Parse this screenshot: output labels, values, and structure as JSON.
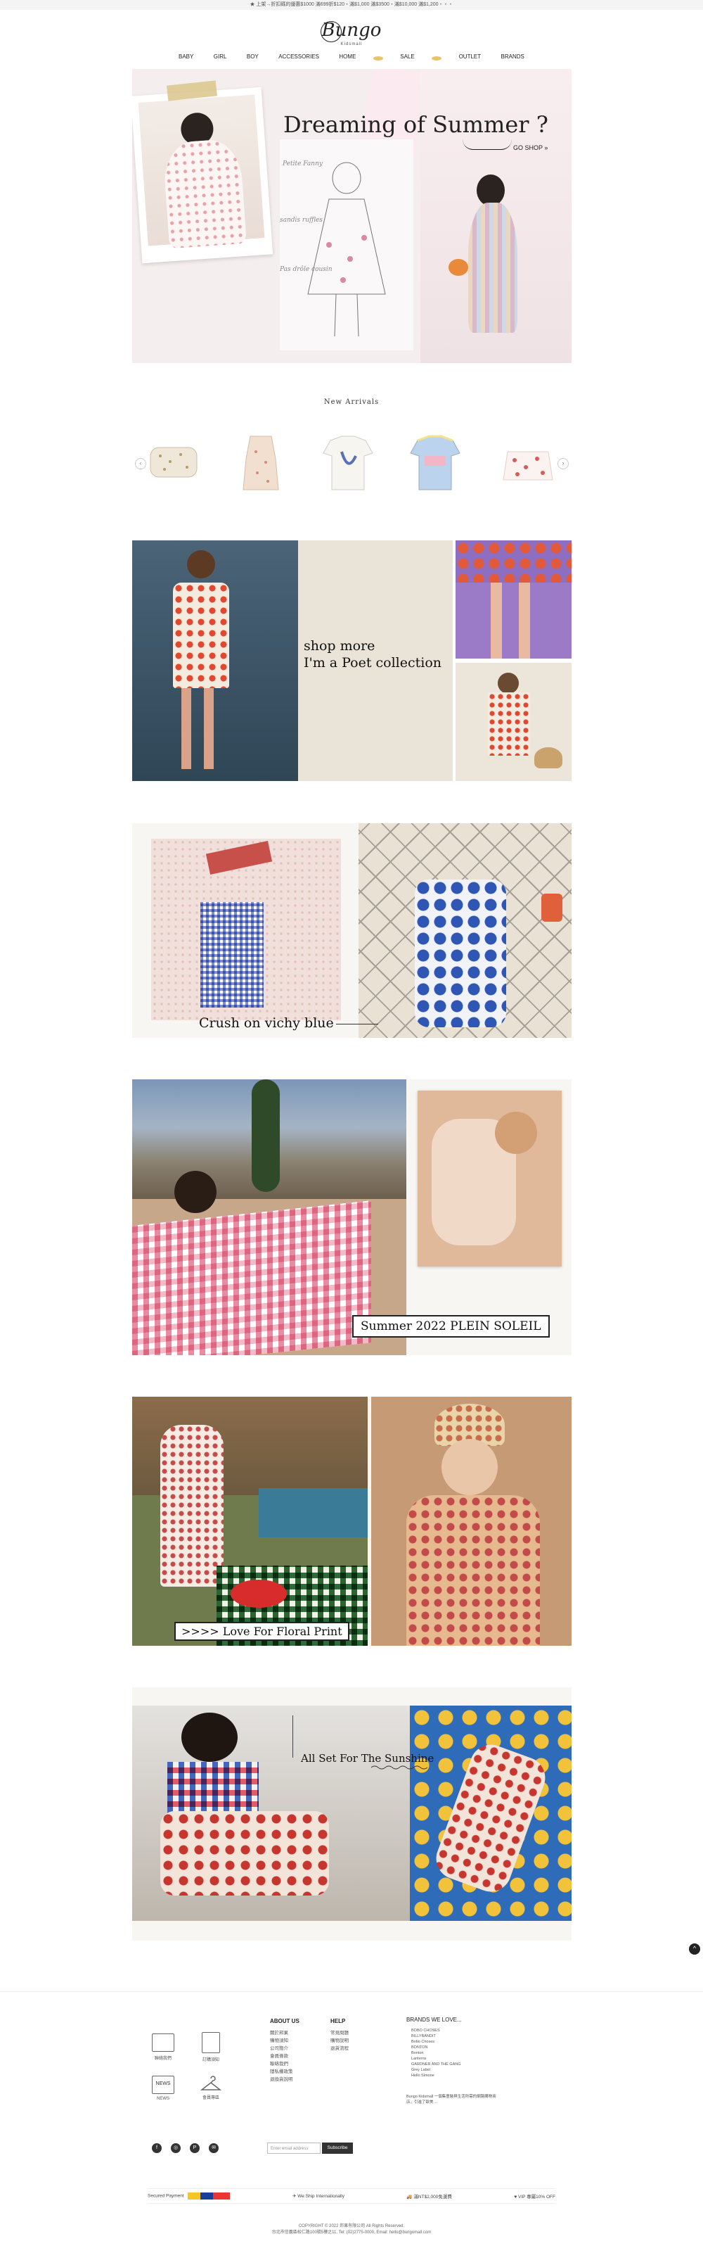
{
  "topbar": {
    "text": "★ 上架→折扣碼的優惠$1000 滿699折$120・滿$1,000 滿$3500・滿$10,000 滿$1,200・・・"
  },
  "logo": {
    "name": "Bungo",
    "tagline": "Kidsmall"
  },
  "nav": {
    "items": [
      "BABY",
      "GIRL",
      "BOY",
      "ACCESSORIES",
      "HOME",
      "SALE",
      "OUTLET",
      "BRANDS"
    ]
  },
  "hero": {
    "title": "Dreaming of Summer ?",
    "cta": "GO SHOP »",
    "sketch_text_1": "Petite Fanny",
    "sketch_text_2": "sandis ruffles",
    "sketch_text_3": "Pas drôle cousin"
  },
  "arrivals": {
    "title": "New Arrivals",
    "prev": "‹",
    "next": "›"
  },
  "sections": {
    "poet": {
      "line1": "shop more",
      "line2": "I'm a Poet collection"
    },
    "vichy": {
      "caption": "Crush on vichy blue"
    },
    "soleil": {
      "caption": "Summer 2022 PLEIN SOLEIL"
    },
    "floral": {
      "caption": ">>>> Love For Floral Print"
    },
    "sunshine": {
      "caption": "All Set For The Sunshine"
    }
  },
  "footer": {
    "icons": [
      {
        "label": "聯絡我們",
        "name": "mail-icon"
      },
      {
        "label": "訂購須知",
        "name": "list-icon"
      },
      {
        "label": "NEWS",
        "name": "news-icon"
      },
      {
        "label": "會員專區",
        "name": "hanger-icon"
      }
    ],
    "about": {
      "title": "ABOUT US",
      "links": [
        "關於邦果",
        "購物須知",
        "公司簡介",
        "會員條款",
        "聯絡我們",
        "隱私權政策",
        "退換貨說明"
      ]
    },
    "help": {
      "title": "HELP",
      "links": [
        "常見問題",
        "購物說明",
        "退貨流程"
      ]
    },
    "brands": {
      "title": "BRANDS WE LOVE...",
      "links": [
        "BOBO CHOSES",
        "BILLYBANDIT",
        "Bobo Choses",
        "BONTON",
        "Bonton",
        "Lanterns",
        "GARDNER AND THE GANG",
        "Grey Label",
        "Hello Simone"
      ],
      "desc": "Bungo Kidsmall 一個集童裝與生活所需的網路購物商店，引進了歐美…"
    },
    "subscribe": {
      "placeholder": "Enter email address",
      "button": "Subscribe"
    },
    "social": [
      "f",
      "◎",
      "P",
      "✉"
    ],
    "pay": {
      "secured": "Secured Payment",
      "ship": "We Ship Internationally",
      "free": "滿NT$2,000免運費",
      "vip": "VIP 專屬10% OFF"
    },
    "copyright": "COPYRIGHT © 2022 邦果有限公司 All Rights Reserved.",
    "address": "台北市信義區松仁路100號5樓之11, Tel: (02)2775-0000, Email: hello@bungomall.com"
  },
  "back_to_top": "^"
}
